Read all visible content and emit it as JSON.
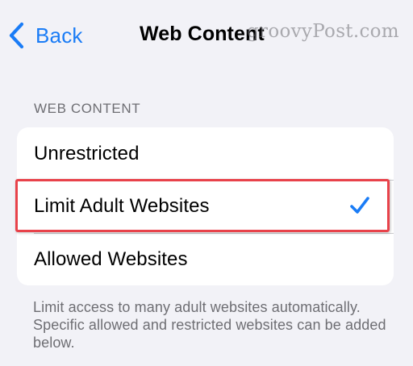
{
  "nav": {
    "back_label": "Back",
    "title": "Web Content",
    "watermark": "groovyPost.com"
  },
  "section": {
    "header": "WEB CONTENT"
  },
  "options": [
    {
      "label": "Unrestricted",
      "selected": false
    },
    {
      "label": "Limit Adult Websites",
      "selected": true
    },
    {
      "label": "Allowed Websites",
      "selected": false
    }
  ],
  "footer": {
    "note": "Limit access to many adult websites automatically. Specific allowed and restricted websites can be added below."
  },
  "colors": {
    "accent": "#1a7cf6",
    "highlight": "#e8424a",
    "background": "#f2f2f7"
  },
  "icons": {
    "back": "chevron-left-icon",
    "selected": "checkmark-icon"
  }
}
